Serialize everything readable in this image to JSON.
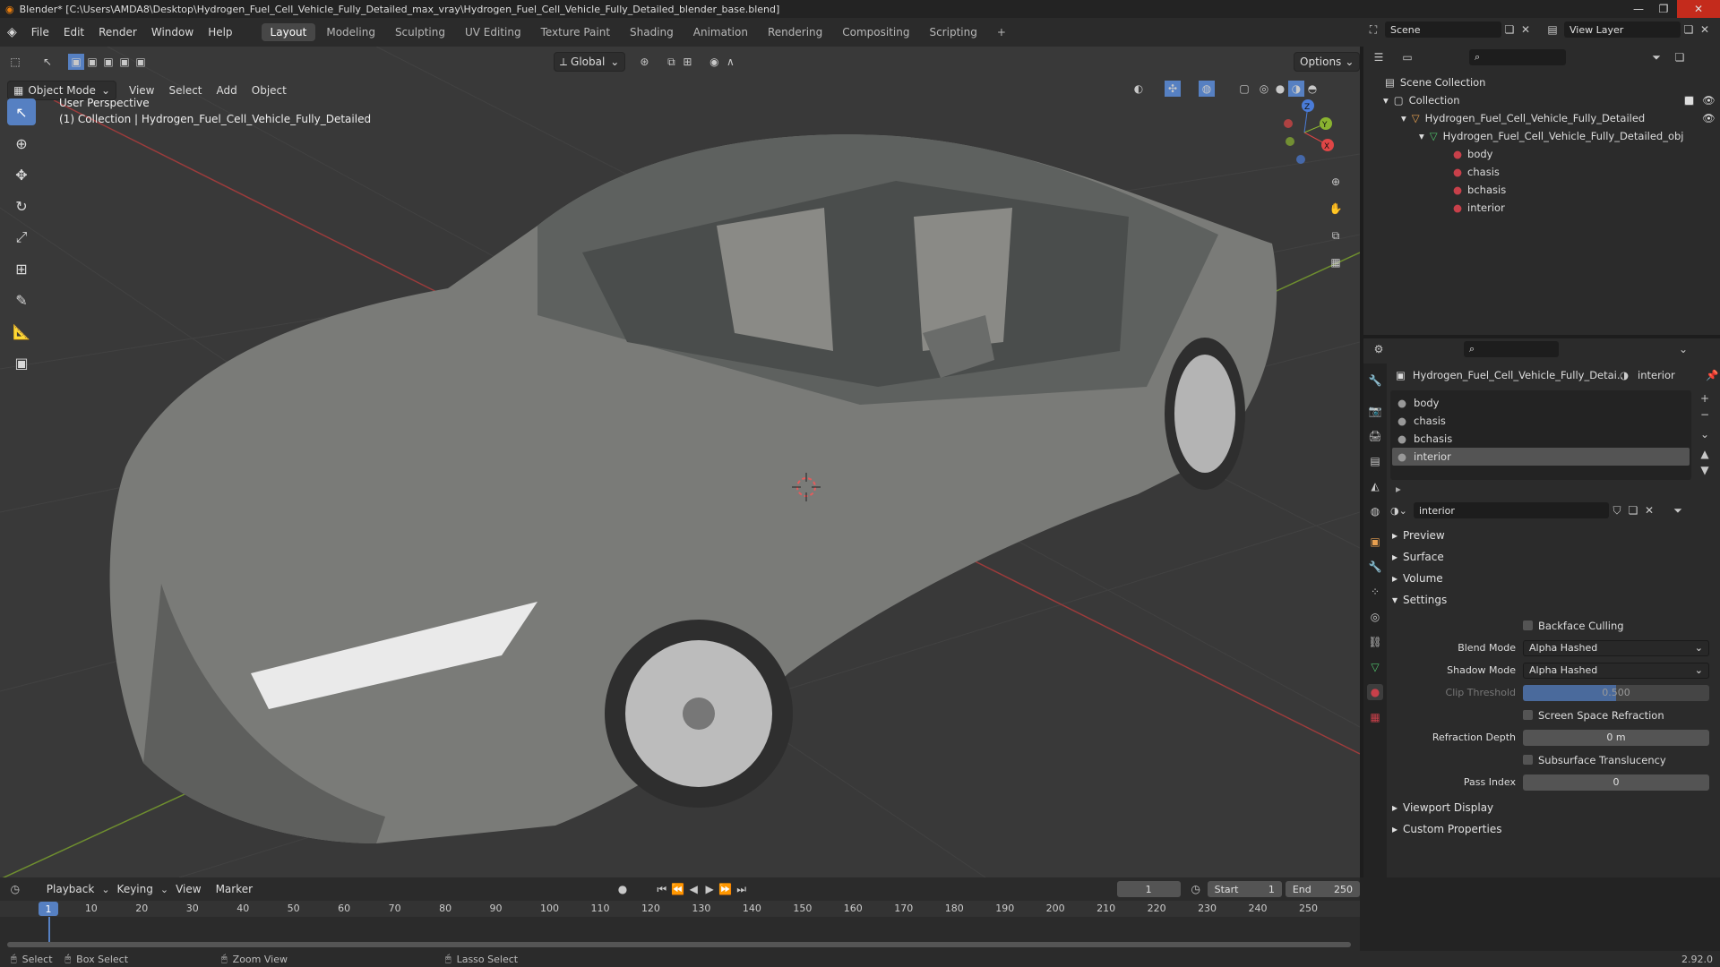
{
  "title_bar": {
    "text": "Blender* [C:\\Users\\AMDA8\\Desktop\\Hydrogen_Fuel_Cell_Vehicle_Fully_Detailed_max_vray\\Hydrogen_Fuel_Cell_Vehicle_Fully_Detailed_blender_base.blend]"
  },
  "menus": [
    "File",
    "Edit",
    "Render",
    "Window",
    "Help"
  ],
  "workspaces": [
    "Layout",
    "Modeling",
    "Sculpting",
    "UV Editing",
    "Texture Paint",
    "Shading",
    "Animation",
    "Rendering",
    "Compositing",
    "Scripting",
    "+"
  ],
  "active_workspace": "Layout",
  "scene": {
    "label": "Scene",
    "view_layer": "View Layer"
  },
  "viewport": {
    "mode": "Object Mode",
    "menus": [
      "View",
      "Select",
      "Add",
      "Object"
    ],
    "transform": "Global",
    "options": "Options",
    "overlay_line1": "User Perspective",
    "overlay_line2": "(1) Collection | Hydrogen_Fuel_Cell_Vehicle_Fully_Detailed",
    "gizmo": {
      "x": "X",
      "y": "Y",
      "z": "Z"
    }
  },
  "outliner": {
    "root": "Scene Collection",
    "collection": "Collection",
    "object": "Hydrogen_Fuel_Cell_Vehicle_Fully_Detailed",
    "mesh": "Hydrogen_Fuel_Cell_Vehicle_Fully_Detailed_obj",
    "materials": [
      "body",
      "chasis",
      "bchasis",
      "interior"
    ]
  },
  "properties": {
    "breadcrumb_object": "Hydrogen_Fuel_Cell_Vehicle_Fully_Detai...",
    "breadcrumb_material": "interior",
    "slots": [
      "body",
      "chasis",
      "bchasis",
      "interior"
    ],
    "selected_slot": "interior",
    "material_name": "interior",
    "sections": {
      "preview": "Preview",
      "surface": "Surface",
      "volume": "Volume",
      "settings": "Settings",
      "viewport_display": "Viewport Display",
      "custom_properties": "Custom Properties"
    },
    "settings": {
      "backface_culling": "Backface Culling",
      "blend_mode_label": "Blend Mode",
      "blend_mode": "Alpha Hashed",
      "shadow_mode_label": "Shadow Mode",
      "shadow_mode": "Alpha Hashed",
      "clip_threshold_label": "Clip Threshold",
      "clip_threshold": "0.500",
      "screen_space_refraction": "Screen Space Refraction",
      "refraction_depth_label": "Refraction Depth",
      "refraction_depth": "0 m",
      "subsurface_translucency": "Subsurface Translucency",
      "pass_index_label": "Pass Index",
      "pass_index": "0"
    }
  },
  "timeline": {
    "menus": [
      "Playback",
      "Keying",
      "View",
      "Marker"
    ],
    "current_frame": "1",
    "start_label": "Start",
    "start": "1",
    "end_label": "End",
    "end": "250",
    "ticks": [
      "1",
      "10",
      "20",
      "30",
      "40",
      "50",
      "60",
      "70",
      "80",
      "90",
      "100",
      "110",
      "120",
      "130",
      "140",
      "150",
      "160",
      "170",
      "180",
      "190",
      "200",
      "210",
      "220",
      "230",
      "240",
      "250"
    ]
  },
  "status": {
    "select": "Select",
    "box_select": "Box Select",
    "zoom_view": "Zoom View",
    "lasso_select": "Lasso Select",
    "version": "2.92.0"
  },
  "colors": {
    "accent": "#5680c2",
    "viewport_bg": "#393939",
    "panel_bg": "#2b2b2b",
    "material_icon": "#c8404a"
  }
}
